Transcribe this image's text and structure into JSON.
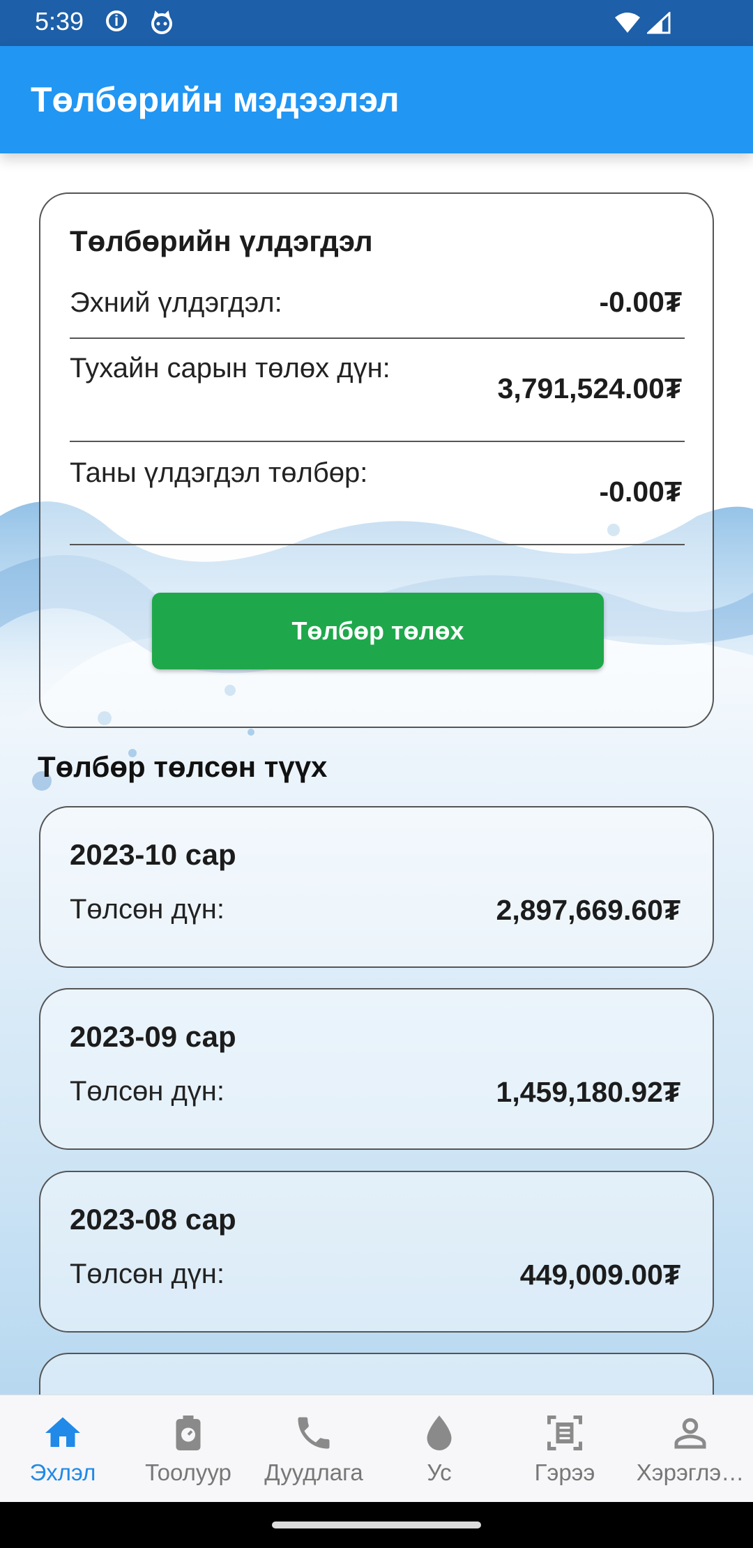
{
  "status_bar": {
    "time": "5:39",
    "icons": [
      "info-icon",
      "cat-icon",
      "wifi-icon",
      "signal-icon"
    ]
  },
  "app_bar": {
    "title": "Төлбөрийн мэдээлэл",
    "color": "#2196f3"
  },
  "balance": {
    "title": "Төлбөрийн үлдэгдэл",
    "rows": [
      {
        "label": "Эхний үлдэгдэл:",
        "value": "-0.00₮"
      },
      {
        "label": "Тухайн сарын төлөх дүн:",
        "value": "3,791,524.00₮"
      },
      {
        "label": "Таны үлдэгдэл төлбөр:",
        "value": "-0.00₮"
      }
    ],
    "pay_button": "Төлбөр төлөх",
    "pay_button_color": "#1ea84b"
  },
  "history": {
    "title": "Төлбөр төлсөн түүх",
    "items": [
      {
        "month": "2023-10 сар",
        "label": "Төлсөн дүн:",
        "amount": "2,897,669.60₮"
      },
      {
        "month": "2023-09 сар",
        "label": "Төлсөн дүн:",
        "amount": "1,459,180.92₮"
      },
      {
        "month": "2023-08 сар",
        "label": "Төлсөн дүн:",
        "amount": "449,009.00₮"
      }
    ]
  },
  "bottom_nav": {
    "active_color": "#2189e8",
    "items": [
      {
        "label": "Эхлэл",
        "icon": "home-icon",
        "active": true
      },
      {
        "label": "Тоолуур",
        "icon": "meter-icon",
        "active": false
      },
      {
        "label": "Дуудлага",
        "icon": "phone-icon",
        "active": false
      },
      {
        "label": "Ус",
        "icon": "water-drop-icon",
        "active": false
      },
      {
        "label": "Гэрээ",
        "icon": "contract-icon",
        "active": false
      },
      {
        "label": "Хэрэглэ…",
        "icon": "user-icon",
        "active": false
      }
    ]
  }
}
